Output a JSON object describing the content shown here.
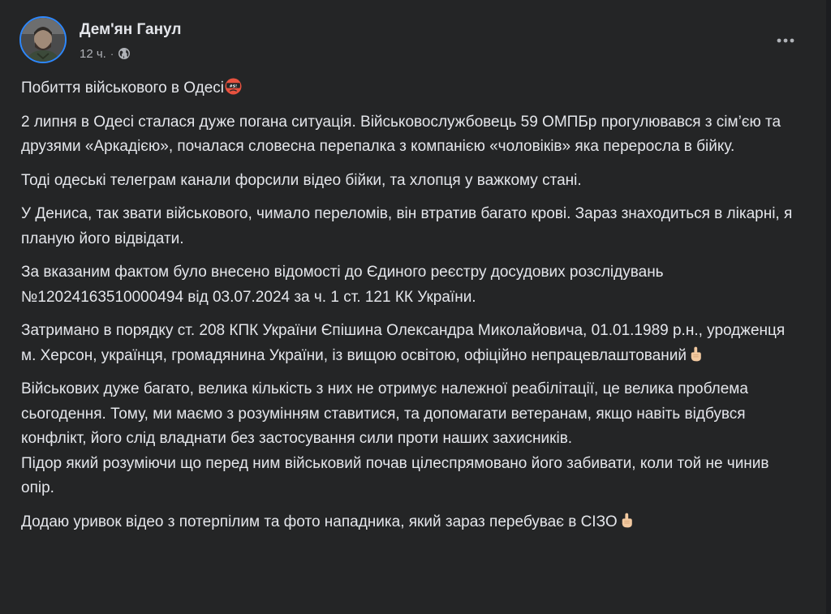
{
  "post": {
    "author": {
      "name": "Дем'ян Ганул",
      "avatar_icon": "avatar-photo"
    },
    "timestamp": "12 ч.",
    "separator": "·",
    "privacy_icon": "globe-icon",
    "more_icon": "more-options-icon",
    "paragraphs": [
      {
        "text": "Побиття військового в Одесі",
        "emoji": "angry-face-emoji"
      },
      {
        "text": "2 липня в Одесі сталася дуже погана ситуація. Військовослужбовець 59 ОМПБр прогулювався з сім’єю та друзями «Аркадією», почалася словесна перепалка з компанією «чоловіків» яка переросла в бійку."
      },
      {
        "text": "Тоді одеські телеграм канали форсили відео бійки, та хлопця у важкому стані."
      },
      {
        "text": "У Дениса, так звати військового, чимало переломів, він втратив багато крові. Зараз знаходиться в лікарні, я планую його відвідати."
      },
      {
        "text": "За вказаним фактом було внесено відомості до Єдиного реєстру досудових розслідувань №12024163510000494 від 03.07.2024 за ч. 1 ст. 121 КК України."
      },
      {
        "text": "Затримано в порядку ст. 208 КПК України Єпішина Олександра Миколайовича, 01.01.1989 р.н., уродженця м. Херсон, українця, громадянина України, із вищою освітою, офіційно непрацевлаштований",
        "emoji": "index-pointing-up-emoji"
      },
      {
        "text": "Військових дуже багато, велика кількість з них не отримує належної реабілітації, це велика проблема сьогодення. Тому, ми маємо з розумінням ставитися, та допомагати ветеранам, якщо навіть відбувся конфлікт, його слід владнати без застосування сили проти наших захисників."
      },
      {
        "text": "Підор який розуміючи що перед ним військовий почав цілеспрямовано його забивати, коли той не чинив опір."
      },
      {
        "text": "Додаю уривок відео з потерпілим та фото нападника, який зараз перебуває в СІЗО",
        "emoji": "index-pointing-up-emoji"
      }
    ]
  },
  "colors": {
    "background": "#242526",
    "text_primary": "#e4e6eb",
    "text_secondary": "#b0b3b8",
    "avatar_ring": "#2d88ff"
  }
}
